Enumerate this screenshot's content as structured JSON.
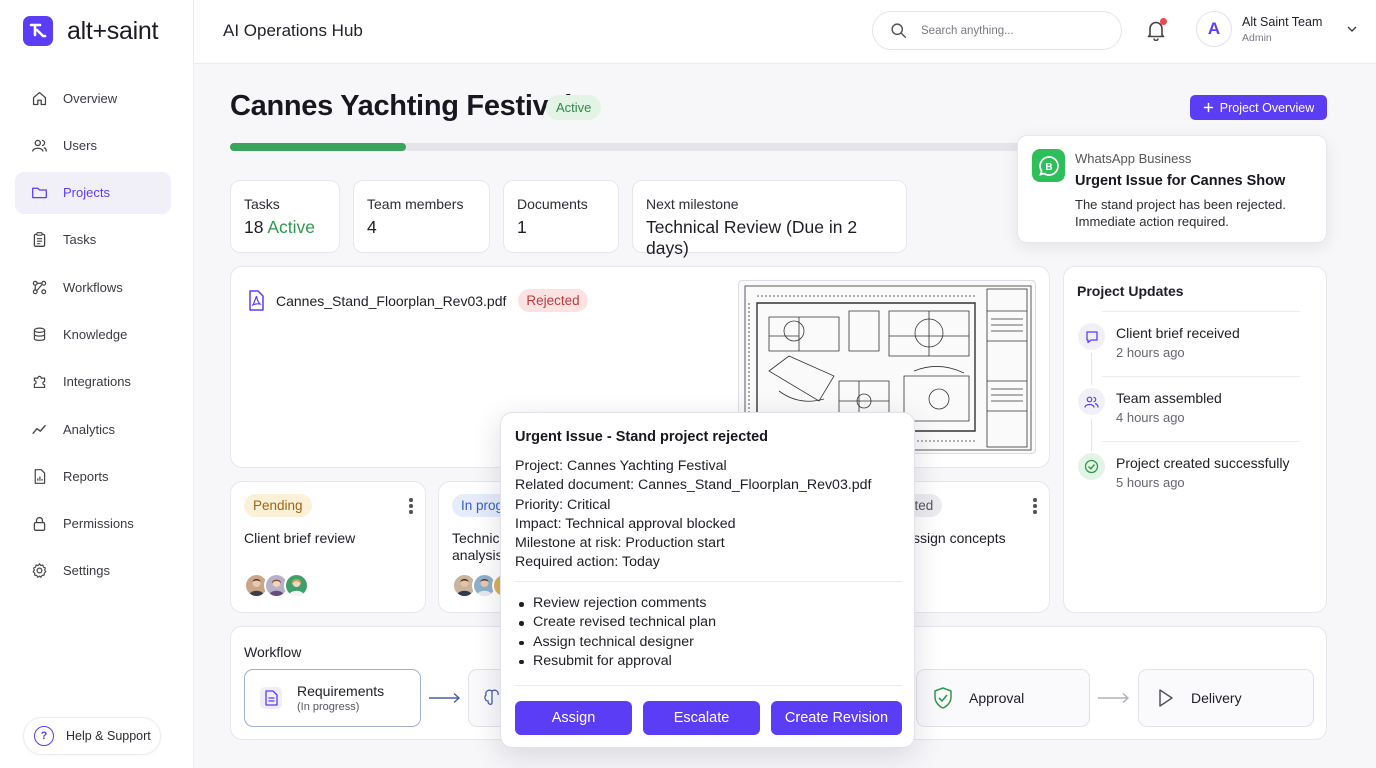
{
  "brand": {
    "name": "alt+saint",
    "color": "#5b3df5"
  },
  "sidebar": {
    "items": [
      {
        "label": "Overview",
        "icon": "home-icon"
      },
      {
        "label": "Users",
        "icon": "users-icon"
      },
      {
        "label": "Projects",
        "icon": "folder-icon",
        "active": true
      },
      {
        "label": "Tasks",
        "icon": "clipboard-icon"
      },
      {
        "label": "Workflows",
        "icon": "workflow-icon"
      },
      {
        "label": "Knowledge",
        "icon": "database-icon"
      },
      {
        "label": "Integrations",
        "icon": "puzzle-icon"
      },
      {
        "label": "Analytics",
        "icon": "trend-icon"
      },
      {
        "label": "Reports",
        "icon": "report-icon"
      },
      {
        "label": "Permissions",
        "icon": "lock-icon"
      },
      {
        "label": "Settings",
        "icon": "gear-icon"
      }
    ],
    "help_label": "Help & Support"
  },
  "header": {
    "title": "AI Operations Hub",
    "search_placeholder": "Search anything...",
    "user_initial": "A",
    "user_name": "Alt Saint Team",
    "user_role": "Admin"
  },
  "project": {
    "title": "Cannes Yachting Festival",
    "status": "Active",
    "overview_button": "Project Overview",
    "progress": 0.22
  },
  "stats": [
    {
      "label": "Tasks",
      "value_num": "18",
      "value_accent": "Active"
    },
    {
      "label": "Team members",
      "value": "4"
    },
    {
      "label": "Documents",
      "value": "1"
    },
    {
      "label": "Next milestone",
      "value": "Technical Review (Due in 2 days)"
    }
  ],
  "whatsapp": {
    "app": "WhatsApp Business",
    "title": "Urgent Issue for Cannes Show",
    "body": "The stand project has been rejected. Immediate action required."
  },
  "document": {
    "name": "Cannes_Stand_Floorplan_Rev03.pdf",
    "status": "Rejected"
  },
  "updates": {
    "title": "Project Updates",
    "items": [
      {
        "title": "Client brief received",
        "time": "2 hours ago",
        "icon": "message-icon"
      },
      {
        "title": "Team assembled",
        "time": "4 hours ago",
        "icon": "team-icon"
      },
      {
        "title": "Project created successfully",
        "time": "5 hours ago",
        "icon": "check-circle-icon"
      }
    ]
  },
  "tasks": [
    {
      "badge": "Pending",
      "title": "Client brief review"
    },
    {
      "badge": "In prog",
      "title": "Technic\nanalysis"
    },
    {
      "badge": "rted",
      "title": "ssign concepts"
    }
  ],
  "workflow": {
    "title": "Workflow",
    "steps": [
      {
        "label": "Requirements",
        "sub": "(In progress)"
      },
      {
        "label": "Approval"
      },
      {
        "label": "Delivery"
      }
    ]
  },
  "modal": {
    "title": "Urgent Issue - Stand project rejected",
    "details": [
      "Project: Cannes Yachting Festival",
      "Related document: Cannes_Stand_Floorplan_Rev03.pdf",
      "Priority: Critical",
      "Impact: Technical approval blocked",
      "Milestone at risk: Production start",
      "Required action: Today"
    ],
    "actions": [
      "Review rejection comments",
      "Create revised technical plan",
      "Assign technical designer",
      "Resubmit for approval"
    ],
    "buttons": {
      "assign": "Assign",
      "escalate": "Escalate",
      "revision": "Create Revision"
    }
  }
}
